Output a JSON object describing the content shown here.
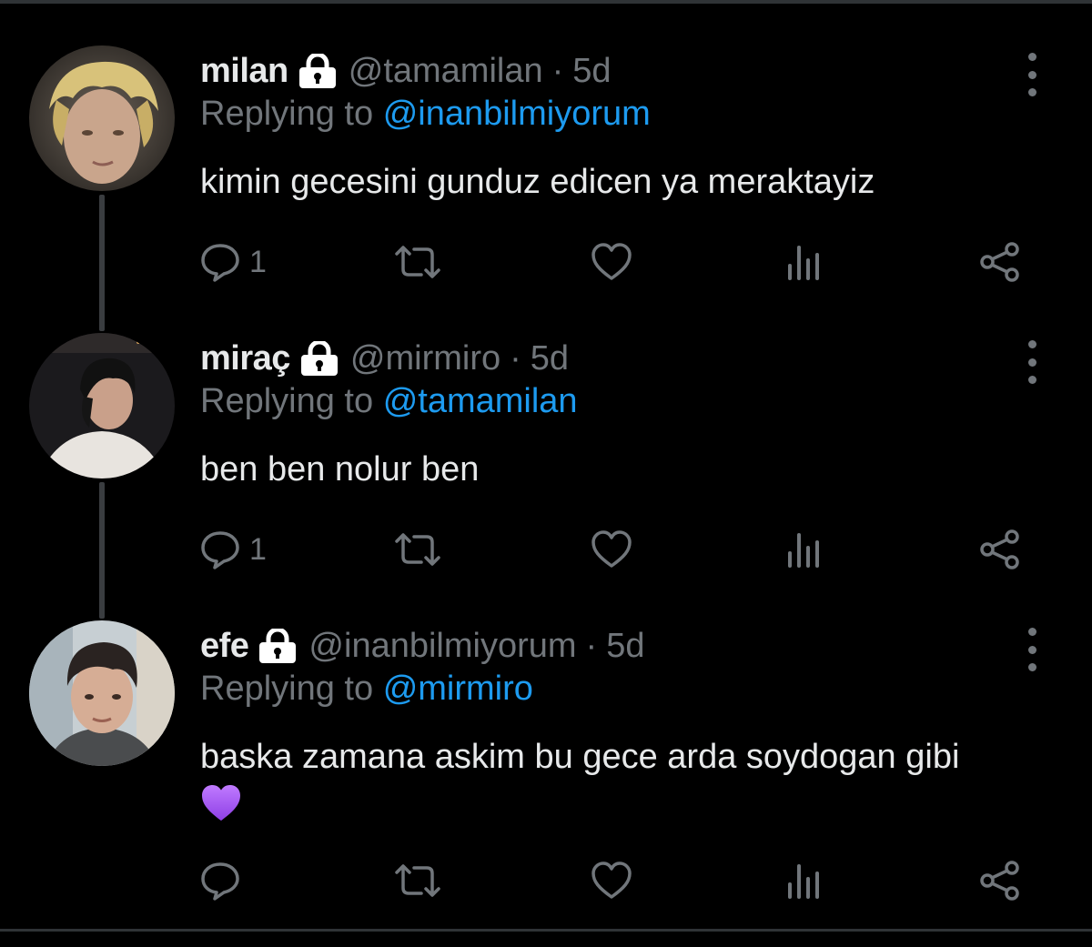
{
  "tweets": [
    {
      "name": "milan",
      "handle": "@tamamilan",
      "separator": "·",
      "time": "5d",
      "replying_label": "Replying to",
      "replying_to": "@inanbilmiyorum",
      "text": "kimin gecesini gunduz edicen ya meraktayiz",
      "reply_count": "1",
      "avatar_desc": "blond curly-haired person"
    },
    {
      "name": "miraç",
      "handle": "@mirmiro",
      "separator": "·",
      "time": "5d",
      "replying_label": "Replying to",
      "replying_to": "@tamamilan",
      "text": "ben ben nolur ben",
      "reply_count": "1",
      "avatar_desc": "dark-haired person in white shirt"
    },
    {
      "name": "efe",
      "handle": "@inanbilmiyorum",
      "separator": "·",
      "time": "5d",
      "replying_label": "Replying to",
      "replying_to": "@mirmiro",
      "text": "baska zamana askim bu gece arda soydogan gibi",
      "emoji": "purple-heart",
      "reply_count": "",
      "avatar_desc": "dark-haired person in car"
    }
  ],
  "icons": {
    "lock": "lock-icon",
    "reply": "speech-bubble-icon",
    "retweet": "retweet-icon",
    "like": "heart-icon",
    "views": "bar-chart-icon",
    "share": "share-icon",
    "more": "vertical-ellipsis-icon"
  },
  "colors": {
    "background": "#000000",
    "text": "#e7e9ea",
    "muted": "#71767b",
    "link": "#1d9bf0",
    "thread_line": "#3a3d40",
    "emoji_heart": "#a95cf5"
  }
}
